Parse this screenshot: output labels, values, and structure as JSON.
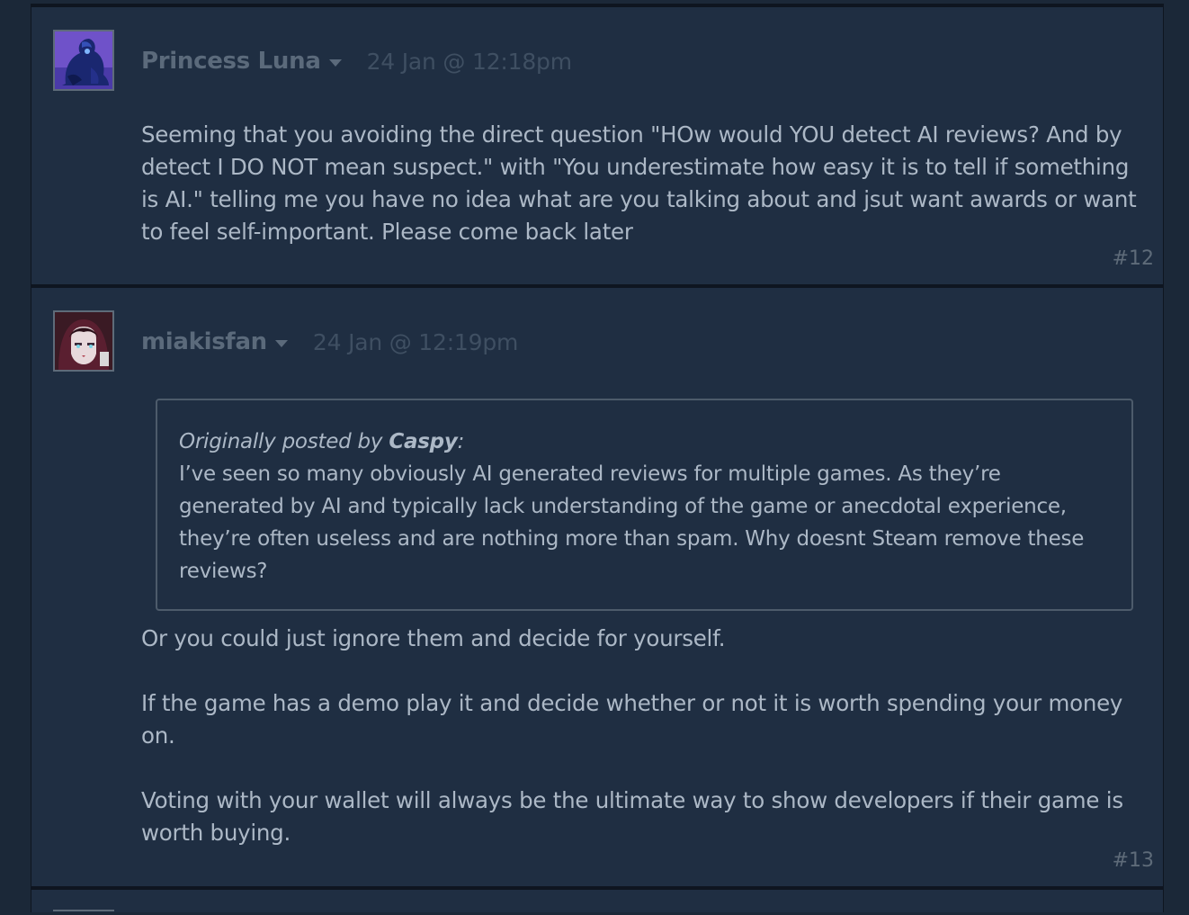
{
  "posts": [
    {
      "author": "Princess Luna",
      "avatar": "princess-luna-avatar",
      "timestamp": "24 Jan @ 12:18pm",
      "body": "Seeming that you avoiding the direct question \"HOw would YOU detect AI reviews? And by detect I DO NOT mean suspect.\" with \"You underestimate how easy it is to tell if something is AI.\" telling me you have no idea what are you talking about and jsut want awards or want to feel self-important. Please come back later",
      "number": "#12"
    },
    {
      "author": "miakisfan",
      "avatar": "miakisfan-avatar",
      "timestamp": "24 Jan @ 12:19pm",
      "quote": {
        "prefix": "Originally posted by",
        "author": "Caspy",
        "suffix": ":",
        "text": "I’ve seen so many obviously AI generated reviews for multiple games. As they’re generated by AI and typically lack understanding of the game or anecdotal experience, they’re often useless and are nothing more than spam. Why doesnt Steam remove these reviews?"
      },
      "paragraphs": [
        "Or you could just ignore them and decide for yourself.",
        "If the game has a demo play it and decide whether or not it is worth spending your money on.",
        "Voting with your wallet will always be the ultimate way to show developers if their game is worth buying."
      ],
      "number": "#13"
    }
  ],
  "colors": {
    "page_background": "#1b2838",
    "post_background": "#1f2e42",
    "author": "#5b6a7b",
    "timestamp": "#3f4f62",
    "body_text": "#acb8c6",
    "quote_border": "#4d5b6b"
  }
}
